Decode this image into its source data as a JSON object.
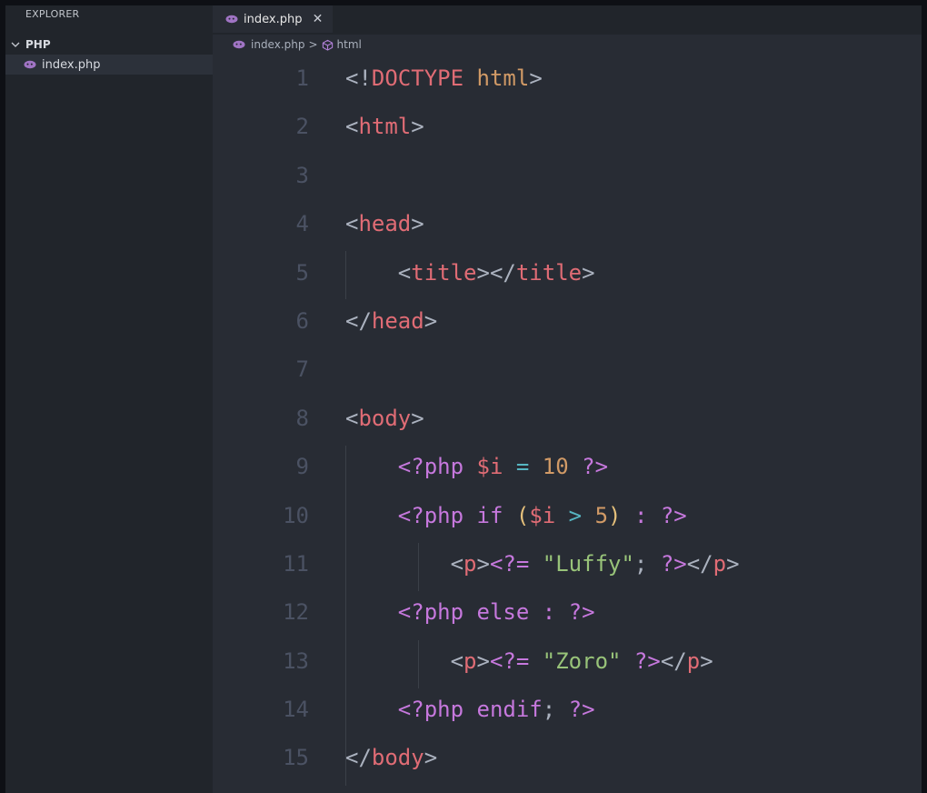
{
  "sidebar": {
    "header": "EXPLORER",
    "folder": "PHP",
    "files": [
      {
        "name": "index.php"
      }
    ]
  },
  "tabs": [
    {
      "label": "index.php",
      "close_glyph": "✕"
    }
  ],
  "breadcrumb": {
    "file": "index.php",
    "separator": ">",
    "symbol": "html"
  },
  "colors": {
    "php_icon": "#a074c4",
    "tag": "#e06c75",
    "keyword": "#c678dd",
    "string": "#98c379",
    "number": "#d19a66",
    "operator": "#56b6c2",
    "punctuation": "#abb2bf"
  },
  "editor": {
    "lines": [
      {
        "n": "1",
        "tokens": [
          [
            "punct",
            "<!"
          ],
          [
            "tag",
            "DOCTYPE"
          ],
          [
            "punct",
            " "
          ],
          [
            "attr",
            "html"
          ],
          [
            "punct",
            ">"
          ]
        ]
      },
      {
        "n": "2",
        "tokens": [
          [
            "punct",
            "<"
          ],
          [
            "tag",
            "html"
          ],
          [
            "punct",
            ">"
          ]
        ]
      },
      {
        "n": "3",
        "tokens": []
      },
      {
        "n": "4",
        "tokens": [
          [
            "punct",
            "<"
          ],
          [
            "tag",
            "head"
          ],
          [
            "punct",
            ">"
          ]
        ]
      },
      {
        "n": "5",
        "tokens": [
          [
            "punct",
            "    <"
          ],
          [
            "tag",
            "title"
          ],
          [
            "punct",
            "></"
          ],
          [
            "tag",
            "title"
          ],
          [
            "punct",
            ">"
          ]
        ]
      },
      {
        "n": "6",
        "tokens": [
          [
            "punct",
            "</"
          ],
          [
            "tag",
            "head"
          ],
          [
            "punct",
            ">"
          ]
        ]
      },
      {
        "n": "7",
        "tokens": []
      },
      {
        "n": "8",
        "tokens": [
          [
            "punct",
            "<"
          ],
          [
            "tag",
            "body"
          ],
          [
            "punct",
            ">"
          ]
        ]
      },
      {
        "n": "9",
        "tokens": [
          [
            "punct",
            "    "
          ],
          [
            "php",
            "<?php"
          ],
          [
            "punct",
            " "
          ],
          [
            "var",
            "$i"
          ],
          [
            "punct",
            " "
          ],
          [
            "op",
            "="
          ],
          [
            "punct",
            " "
          ],
          [
            "num",
            "10"
          ],
          [
            "punct",
            " "
          ],
          [
            "php",
            "?>"
          ]
        ]
      },
      {
        "n": "10",
        "tokens": [
          [
            "punct",
            "    "
          ],
          [
            "php",
            "<?php"
          ],
          [
            "punct",
            " "
          ],
          [
            "kw",
            "if"
          ],
          [
            "punct",
            " "
          ],
          [
            "paren",
            "("
          ],
          [
            "var",
            "$i"
          ],
          [
            "punct",
            " "
          ],
          [
            "op",
            ">"
          ],
          [
            "punct",
            " "
          ],
          [
            "num",
            "5"
          ],
          [
            "paren",
            ")"
          ],
          [
            "punct",
            " "
          ],
          [
            "kw",
            ":"
          ],
          [
            "punct",
            " "
          ],
          [
            "php",
            "?>"
          ]
        ]
      },
      {
        "n": "11",
        "tokens": [
          [
            "punct",
            "        <"
          ],
          [
            "tag",
            "p"
          ],
          [
            "punct",
            ">"
          ],
          [
            "php",
            "<?="
          ],
          [
            "punct",
            " "
          ],
          [
            "str",
            "\"Luffy\""
          ],
          [
            "punct",
            "; "
          ],
          [
            "php",
            "?>"
          ],
          [
            "punct",
            "</"
          ],
          [
            "tag",
            "p"
          ],
          [
            "punct",
            ">"
          ]
        ]
      },
      {
        "n": "12",
        "tokens": [
          [
            "punct",
            "    "
          ],
          [
            "php",
            "<?php"
          ],
          [
            "punct",
            " "
          ],
          [
            "kw",
            "else"
          ],
          [
            "punct",
            " "
          ],
          [
            "kw",
            ":"
          ],
          [
            "punct",
            " "
          ],
          [
            "php",
            "?>"
          ]
        ]
      },
      {
        "n": "13",
        "tokens": [
          [
            "punct",
            "        <"
          ],
          [
            "tag",
            "p"
          ],
          [
            "punct",
            ">"
          ],
          [
            "php",
            "<?="
          ],
          [
            "punct",
            " "
          ],
          [
            "str",
            "\"Zoro\""
          ],
          [
            "punct",
            " "
          ],
          [
            "php",
            "?>"
          ],
          [
            "punct",
            "</"
          ],
          [
            "tag",
            "p"
          ],
          [
            "punct",
            ">"
          ]
        ]
      },
      {
        "n": "14",
        "tokens": [
          [
            "punct",
            "    "
          ],
          [
            "php",
            "<?php"
          ],
          [
            "punct",
            " "
          ],
          [
            "kw",
            "endif"
          ],
          [
            "punct",
            "; "
          ],
          [
            "php",
            "?>"
          ]
        ]
      },
      {
        "n": "15",
        "tokens": [
          [
            "punct",
            "</"
          ],
          [
            "tag",
            "body"
          ],
          [
            "punct",
            ">"
          ]
        ]
      }
    ]
  }
}
